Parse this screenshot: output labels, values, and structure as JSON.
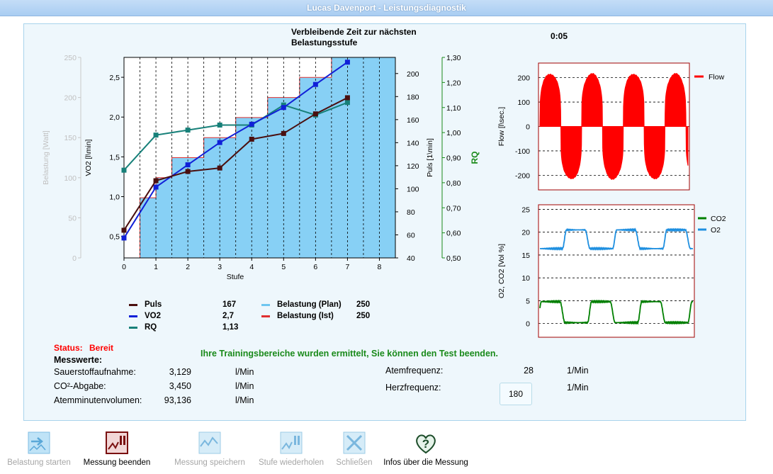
{
  "window": {
    "title": "Lucas Davenport - Leistungsdiagnostik"
  },
  "header": {
    "countdown_label": "Verbleibende Zeit zur nächsten Belastungsstufe",
    "countdown_line1": "Verbleibende Zeit zur nächsten",
    "countdown_line2": "Belastungsstufe",
    "countdown_value": "0:05"
  },
  "main_chart": {
    "xlabel": "Stufe",
    "left_gray_axis": {
      "label": "Belastung [Watt]",
      "ticks": [
        "250",
        "200",
        "150",
        "100",
        "50",
        "0"
      ]
    },
    "left_axis": {
      "label": "VO2 [l\\min]",
      "ticks": [
        "2,5",
        "2,0",
        "1,5",
        "1,0",
        "0,5"
      ]
    },
    "right_axis": {
      "label": "Puls [1\\min]",
      "ticks": [
        "200",
        "180",
        "160",
        "140",
        "120",
        "100",
        "80",
        "60",
        "40"
      ]
    },
    "rq_axis": {
      "label": "RQ",
      "ticks": [
        "1,30",
        "1,20",
        "1,10",
        "1,00",
        "0,90",
        "0,80",
        "0,70",
        "0,60",
        "0,50"
      ]
    },
    "x_ticks": [
      "0",
      "1",
      "2",
      "3",
      "4",
      "5",
      "6",
      "7",
      "8"
    ]
  },
  "chart_data": [
    {
      "type": "line",
      "title": "",
      "xlabel": "Stufe",
      "x": [
        0,
        1,
        2,
        3,
        4,
        5,
        6,
        7
      ],
      "xlim": [
        0,
        8.5
      ],
      "series": [
        {
          "name": "Puls",
          "axis": "Puls [1\\min]",
          "color": "#4a0f0f",
          "x": [
            0,
            1,
            2,
            3,
            4,
            5,
            6,
            7
          ],
          "values": [
            64,
            107,
            115,
            118,
            143,
            148,
            165,
            179
          ]
        },
        {
          "name": "VO2",
          "axis": "VO2 [l\\min]",
          "color": "#1020d8",
          "x": [
            0,
            1,
            2,
            3,
            4,
            5,
            6,
            7
          ],
          "values": [
            0.48,
            1.12,
            1.4,
            1.68,
            1.91,
            2.12,
            2.41,
            2.69
          ]
        },
        {
          "name": "RQ",
          "axis": "RQ",
          "color": "#178079",
          "x": [
            0,
            1,
            2,
            3,
            4,
            5,
            6,
            7
          ],
          "values": [
            0.85,
            0.99,
            1.01,
            1.03,
            1.03,
            1.11,
            1.07,
            1.12
          ]
        },
        {
          "name": "Belastung (Ist)",
          "axis": "Belastung [Watt]",
          "color": "#e03030",
          "type": "step",
          "x": [
            0.5,
            1,
            1.5,
            2.5,
            3.5,
            4.5,
            5.5,
            6.5,
            7.5
          ],
          "values": [
            75,
            100,
            125,
            150,
            175,
            200,
            225,
            250,
            250
          ]
        }
      ],
      "ylim_vo2": [
        0.23,
        2.75
      ],
      "ylim_puls": [
        40,
        214
      ],
      "ylim_rq": [
        0.5,
        1.3
      ],
      "ylim_watt": [
        0,
        250
      ]
    },
    {
      "type": "line",
      "title": "",
      "ylabel": "Flow [l\\sec.]",
      "yticks": [
        "200",
        "100",
        "0",
        "-100",
        "-200"
      ],
      "ylim": [
        -260,
        260
      ],
      "series": [
        {
          "name": "Flow",
          "color": "#ff0000",
          "values": "oscillating breath flow ±250"
        }
      ]
    },
    {
      "type": "line",
      "title": "",
      "ylabel": "O2, CO2 [Vol %]",
      "yticks": [
        "25",
        "20",
        "15",
        "10",
        "5",
        "0"
      ],
      "ylim": [
        -3,
        26
      ],
      "series": [
        {
          "name": "CO2",
          "color": "#008000",
          "values": [
            4.7,
            0.2,
            4.9,
            0.2,
            4.9,
            0.2,
            4.7
          ]
        },
        {
          "name": "O2",
          "color": "#1e8fe0",
          "values": [
            16.3,
            20.5,
            16.6,
            20.4,
            16.4,
            20.6,
            16.5
          ]
        }
      ]
    }
  ],
  "legend": {
    "items": [
      {
        "name": "Puls",
        "value": "167",
        "color": "#4a0f0f"
      },
      {
        "name": "VO2",
        "value": "2,7",
        "color": "#1020d8"
      },
      {
        "name": "RQ",
        "value": "1,13",
        "color": "#178079"
      }
    ],
    "items2": [
      {
        "name": "Belastung (Plan)",
        "value": "250",
        "color": "#6ec6f0"
      },
      {
        "name": "Belastung (Ist)",
        "value": "250",
        "color": "#e03030"
      }
    ]
  },
  "flow_legend": "Flow",
  "gas_legend": [
    "CO2",
    "O2"
  ],
  "status": {
    "label": "Status:",
    "value": "Bereit",
    "message": "Ihre Trainingsbereiche wurden ermittelt, Sie können den Test beenden."
  },
  "measurements": {
    "title": "Messwerte:",
    "left": [
      {
        "label": "Sauerstoffaufnahme:",
        "value": "3,129",
        "unit": "l/Min"
      },
      {
        "label": "CO²-Abgabe:",
        "value": "3,450",
        "unit": "l/Min"
      },
      {
        "label": "Atemminutenvolumen:",
        "value": "93,136",
        "unit": "l/Min"
      }
    ],
    "right": [
      {
        "label": "Atemfrequenz:",
        "value": "28",
        "unit": "1/Min"
      },
      {
        "label": "Herzfrequenz:",
        "value": "180",
        "unit": "1/Min"
      }
    ]
  },
  "toolbar": [
    {
      "label": "Belastung starten",
      "icon": "play-load-icon",
      "enabled": false
    },
    {
      "label": "Messung beenden",
      "icon": "stop-measure-icon",
      "enabled": true
    },
    {
      "label": "Messung speichern",
      "icon": "save-measure-icon",
      "enabled": false
    },
    {
      "label": "Stufe wiederholen",
      "icon": "repeat-stage-icon",
      "enabled": false
    },
    {
      "label": "Schließen",
      "icon": "close-icon",
      "enabled": false
    },
    {
      "label": "Infos über die Messung",
      "icon": "heart-info-icon",
      "enabled": true
    }
  ]
}
